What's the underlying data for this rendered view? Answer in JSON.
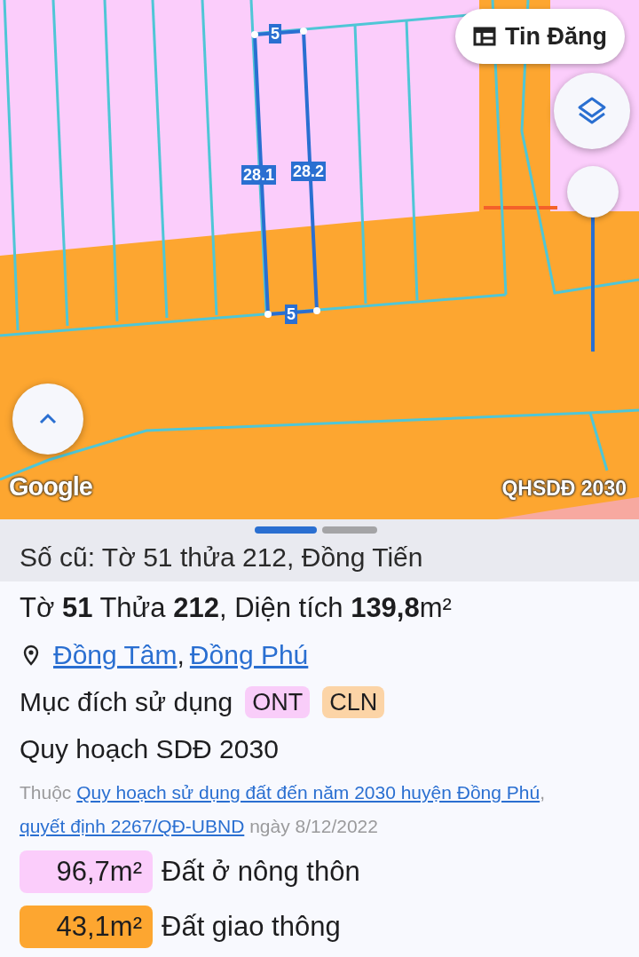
{
  "map": {
    "dimension_labels": [
      {
        "text": "5"
      },
      {
        "text": "28.1"
      },
      {
        "text": "28.2"
      },
      {
        "text": "5"
      }
    ],
    "attribution": "Google",
    "layer_name": "QHSDĐ 2030",
    "zoom_slider": {
      "level": 1
    }
  },
  "post_button": {
    "label": "Tin Đăng"
  },
  "sheet": {
    "old_number": "Số cũ: Tờ 51 thửa 212, Đồng Tiến",
    "title": "Tờ **51** Thửa **212**, Diện tích **139,8**m²",
    "location": {
      "links": [
        "Đồng Tâm",
        "Đồng Phú"
      ],
      "separator": ","
    },
    "purpose": {
      "label": "Mục đích sử dụng",
      "tags": [
        {
          "code": "ONT",
          "color": "#f9cdf9"
        },
        {
          "code": "CLN",
          "color": "#fcd4a6"
        }
      ]
    },
    "plan_title": "Quy hoạch SDĐ 2030",
    "source": {
      "prefix": "Thuộc",
      "links": [
        "Quy hoạch sử dụng đất đến năm 2030 huyện Đồng Phú",
        "quyết định 2267/QĐ-UBND"
      ],
      "separator": ",",
      "suffix": "ngày 8/12/2022"
    },
    "areas": [
      {
        "area": "96,7m²",
        "label": "Đất ở nông thôn",
        "color": "#fbcdfb"
      },
      {
        "area": "43,1m²",
        "label": "Đất giao thông",
        "color": "#fda630"
      }
    ]
  }
}
